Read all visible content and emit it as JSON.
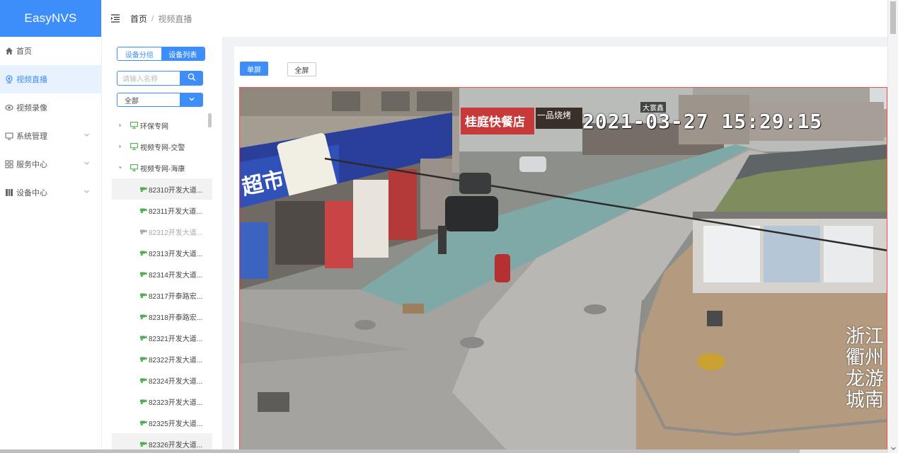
{
  "app": {
    "brand": "EasyNVS"
  },
  "sidebar": {
    "items": [
      {
        "label": "首页",
        "icon": "home-icon"
      },
      {
        "label": "视频直播",
        "icon": "live-icon",
        "active": true
      },
      {
        "label": "视频录像",
        "icon": "record-icon"
      },
      {
        "label": "系统管理",
        "icon": "system-icon",
        "expandable": true
      },
      {
        "label": "服务中心",
        "icon": "grid-icon",
        "expandable": true
      },
      {
        "label": "设备中心",
        "icon": "device-icon",
        "expandable": true
      }
    ]
  },
  "header": {
    "breadcrumb": {
      "home": "首页",
      "separator": "/",
      "current": "视频直播"
    }
  },
  "device_panel": {
    "tabs": {
      "group": "设备分组",
      "list": "设备列表"
    },
    "search": {
      "placeholder": "请输入名称"
    },
    "filter": {
      "value": "全部"
    },
    "tree": {
      "groups": [
        {
          "label": "环保专网",
          "expanded": false
        },
        {
          "label": "视频专网-交警",
          "expanded": false
        },
        {
          "label": "视频专网-海康",
          "expanded": true
        }
      ],
      "devices": [
        {
          "label": "82310开发大道...",
          "online": true,
          "selected": true
        },
        {
          "label": "82311开发大道...",
          "online": true
        },
        {
          "label": "82312开发大道...",
          "online": false
        },
        {
          "label": "82313开发大道...",
          "online": true
        },
        {
          "label": "82314开发大道...",
          "online": true
        },
        {
          "label": "82317开泰路宏...",
          "online": true
        },
        {
          "label": "82318开泰路宏...",
          "online": true
        },
        {
          "label": "82321开发大道...",
          "online": true
        },
        {
          "label": "82322开发大道...",
          "online": true
        },
        {
          "label": "82324开发大道...",
          "online": true
        },
        {
          "label": "82323开发大道...",
          "online": true
        },
        {
          "label": "82325开发大道...",
          "online": true
        },
        {
          "label": "82326开发大道...",
          "online": true,
          "selected": true
        }
      ]
    }
  },
  "player": {
    "buttons": {
      "single": "单屏",
      "full": "全屏"
    },
    "video": {
      "timestamp": "2021-03-27  15:29:15",
      "osd_lines": [
        "浙江",
        "衢州",
        "龙游",
        "城南"
      ],
      "shop_sign": "桂庭快餐店",
      "store_sign": "超市",
      "sign2": "一品烧烤",
      "sign3": "大寰鑫"
    }
  },
  "colors": {
    "primary": "#3d8ef8",
    "active_bg": "#e8f2fe",
    "online": "#4caf50",
    "video_border": "#ff4d4f"
  }
}
